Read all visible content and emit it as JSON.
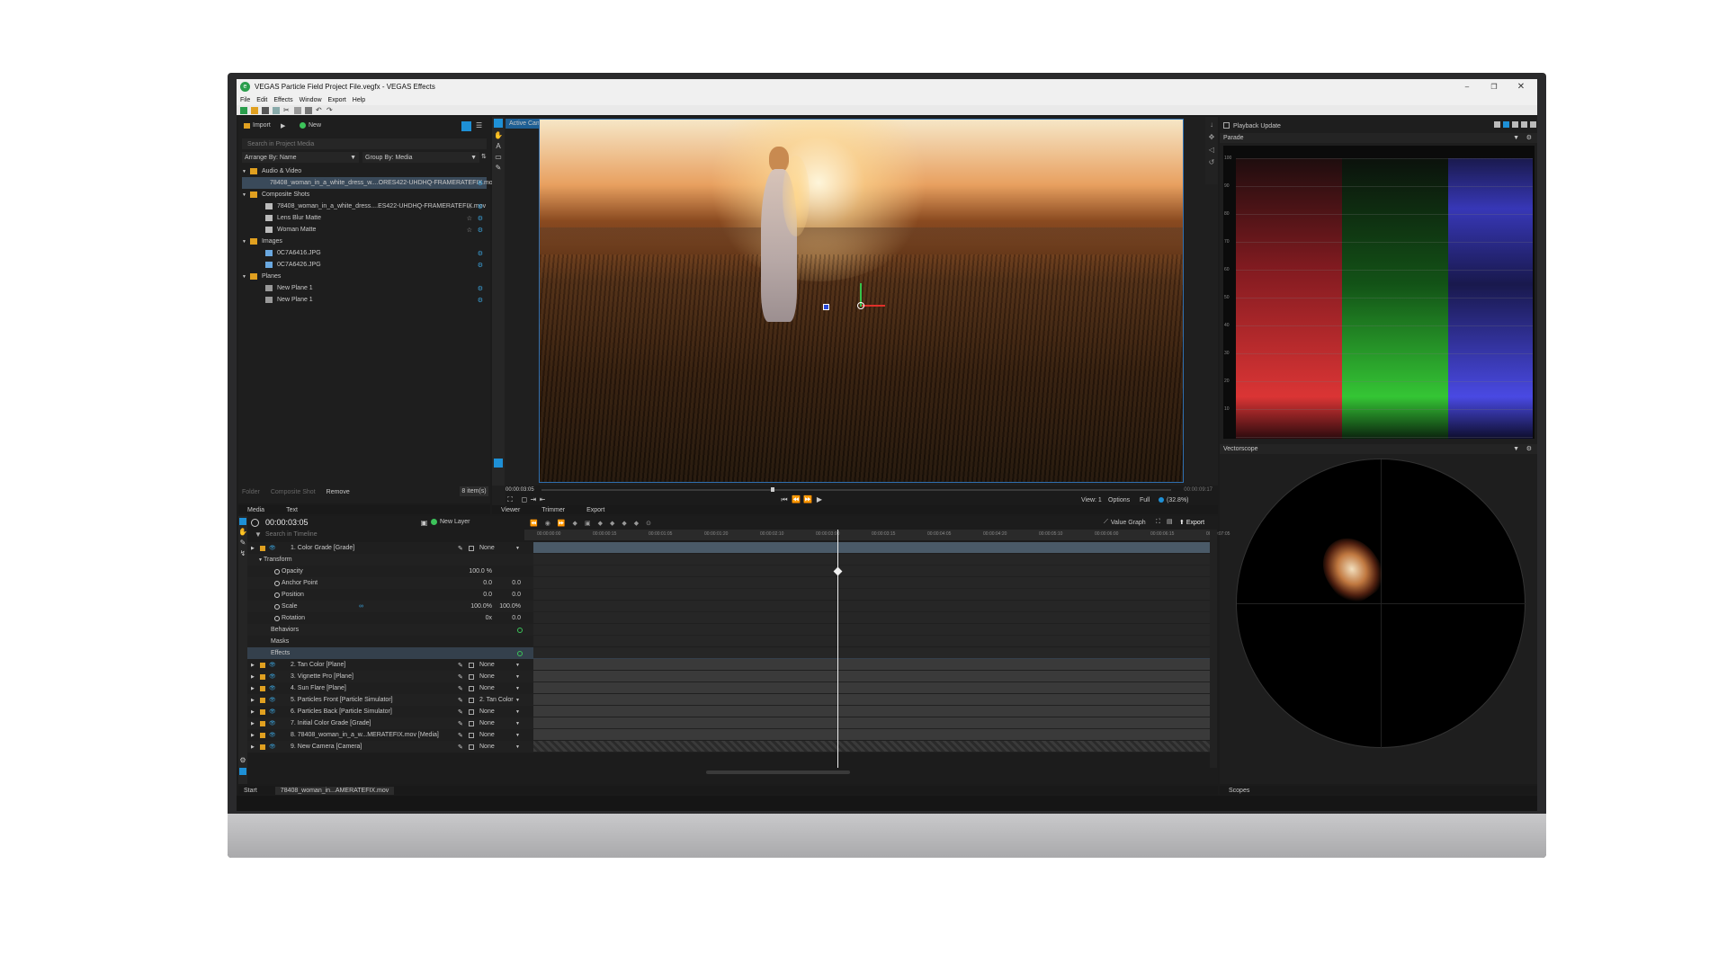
{
  "window": {
    "title": "VEGAS Particle Field Project File.vegfx - VEGAS Effects"
  },
  "menu": [
    "File",
    "Edit",
    "Effects",
    "Window",
    "Export",
    "Help"
  ],
  "project": {
    "import_label": "Import",
    "new_label": "New",
    "search_placeholder": "Search in Project Media",
    "arrange_label": "Arrange By: Name",
    "group_label": "Group By: Media",
    "tree": [
      {
        "label": "Audio & Video",
        "type": "folder"
      },
      {
        "label": "78408_woman_in_a_white_dress_w....ORES422-UHDHQ-FRAMERATEFIX.mov",
        "type": "file",
        "selected": true
      },
      {
        "label": "Composite Shots",
        "type": "folder"
      },
      {
        "label": "78408_woman_in_a_white_dress....ES422-UHDHQ-FRAMERATEFIX.mov",
        "type": "comp"
      },
      {
        "label": "Lens Blur Matte",
        "type": "comp"
      },
      {
        "label": "Woman Matte",
        "type": "comp"
      },
      {
        "label": "Images",
        "type": "folder"
      },
      {
        "label": "0C7A6416.JPG",
        "type": "image"
      },
      {
        "label": "0C7A6426.JPG",
        "type": "image"
      },
      {
        "label": "Planes",
        "type": "folder"
      },
      {
        "label": "New Plane 1",
        "type": "plane"
      },
      {
        "label": "New Plane 1",
        "type": "plane"
      }
    ],
    "footer": {
      "folder": "Folder",
      "composite": "Composite Shot",
      "remove": "Remove",
      "count": "8 item(s)"
    },
    "tabs": [
      "Media",
      "Text"
    ]
  },
  "viewer": {
    "camera_label": "Active Camera",
    "time_left": "00:00:03:05",
    "time_right": "00:00:09:17",
    "view_label": "View: 1",
    "options_label": "Options",
    "quality_label": "Full",
    "zoom_label": "(32.8%)",
    "tabs": [
      "Viewer",
      "Trimmer",
      "Export"
    ]
  },
  "scopes": {
    "playback_label": "Playback Update",
    "parade_label": "Parade",
    "parade_ticks": [
      "100",
      "90",
      "80",
      "70",
      "60",
      "50",
      "40",
      "30",
      "20",
      "10"
    ],
    "vectorscope_label": "Vectorscope",
    "tab": "Scopes"
  },
  "timeline": {
    "timecode": "00:00:03:05",
    "new_layer": "New Layer",
    "search_placeholder": "Search in Timeline",
    "value_graph": "Value Graph",
    "export_label": "Export",
    "ruler": [
      "00:00:00:00",
      "00:00:00:15",
      "00:00:01:05",
      "00:00:01:20",
      "00:00:02:10",
      "00:00:03:00",
      "00:00:03:15",
      "00:00:04:05",
      "00:00:04:20",
      "00:00:05:10",
      "00:00:06:00",
      "00:00:06:15",
      "00:00:07:05"
    ],
    "rows": [
      {
        "label": "1. Color Grade [Grade]",
        "kind": "layer",
        "parent": "None"
      },
      {
        "label": "Transform",
        "kind": "group"
      },
      {
        "label": "Opacity",
        "kind": "prop",
        "v1": "100.0 %",
        "v2": ""
      },
      {
        "label": "Anchor Point",
        "kind": "prop",
        "v1": "0.0",
        "v2": "0.0"
      },
      {
        "label": "Position",
        "kind": "prop",
        "v1": "0.0",
        "v2": "0.0"
      },
      {
        "label": "Scale",
        "kind": "prop",
        "v1": "100.0%",
        "v2": "100.0%"
      },
      {
        "label": "Rotation",
        "kind": "prop",
        "v1": "0x",
        "v2": "0.0"
      },
      {
        "label": "Behaviors",
        "kind": "sub"
      },
      {
        "label": "Masks",
        "kind": "sub"
      },
      {
        "label": "Effects",
        "kind": "sub"
      },
      {
        "label": "2. Tan Color [Plane]",
        "kind": "layer",
        "parent": "None"
      },
      {
        "label": "3. Vignette Pro [Plane]",
        "kind": "layer",
        "parent": "None"
      },
      {
        "label": "4. Sun Flare [Plane]",
        "kind": "layer",
        "parent": "None"
      },
      {
        "label": "5. Particles Front [Particle Simulator]",
        "kind": "layer",
        "parent": "2. Tan Color"
      },
      {
        "label": "6. Particles Back [Particle Simulator]",
        "kind": "layer",
        "parent": "None"
      },
      {
        "label": "7. Initial Color Grade [Grade]",
        "kind": "layer",
        "parent": "None"
      },
      {
        "label": "8. 78408_woman_in_a_w...MERATEFIX.mov [Media]",
        "kind": "layer",
        "parent": "None"
      },
      {
        "label": "9. New Camera [Camera]",
        "kind": "layer",
        "parent": "None"
      }
    ]
  },
  "bottom_tabs": [
    "Start",
    "78408_woman_in...AMERATEFIX.mov"
  ],
  "colors": {
    "accent": "#1e90d6",
    "green": "#3cc35a",
    "folder": "#e0a020"
  }
}
